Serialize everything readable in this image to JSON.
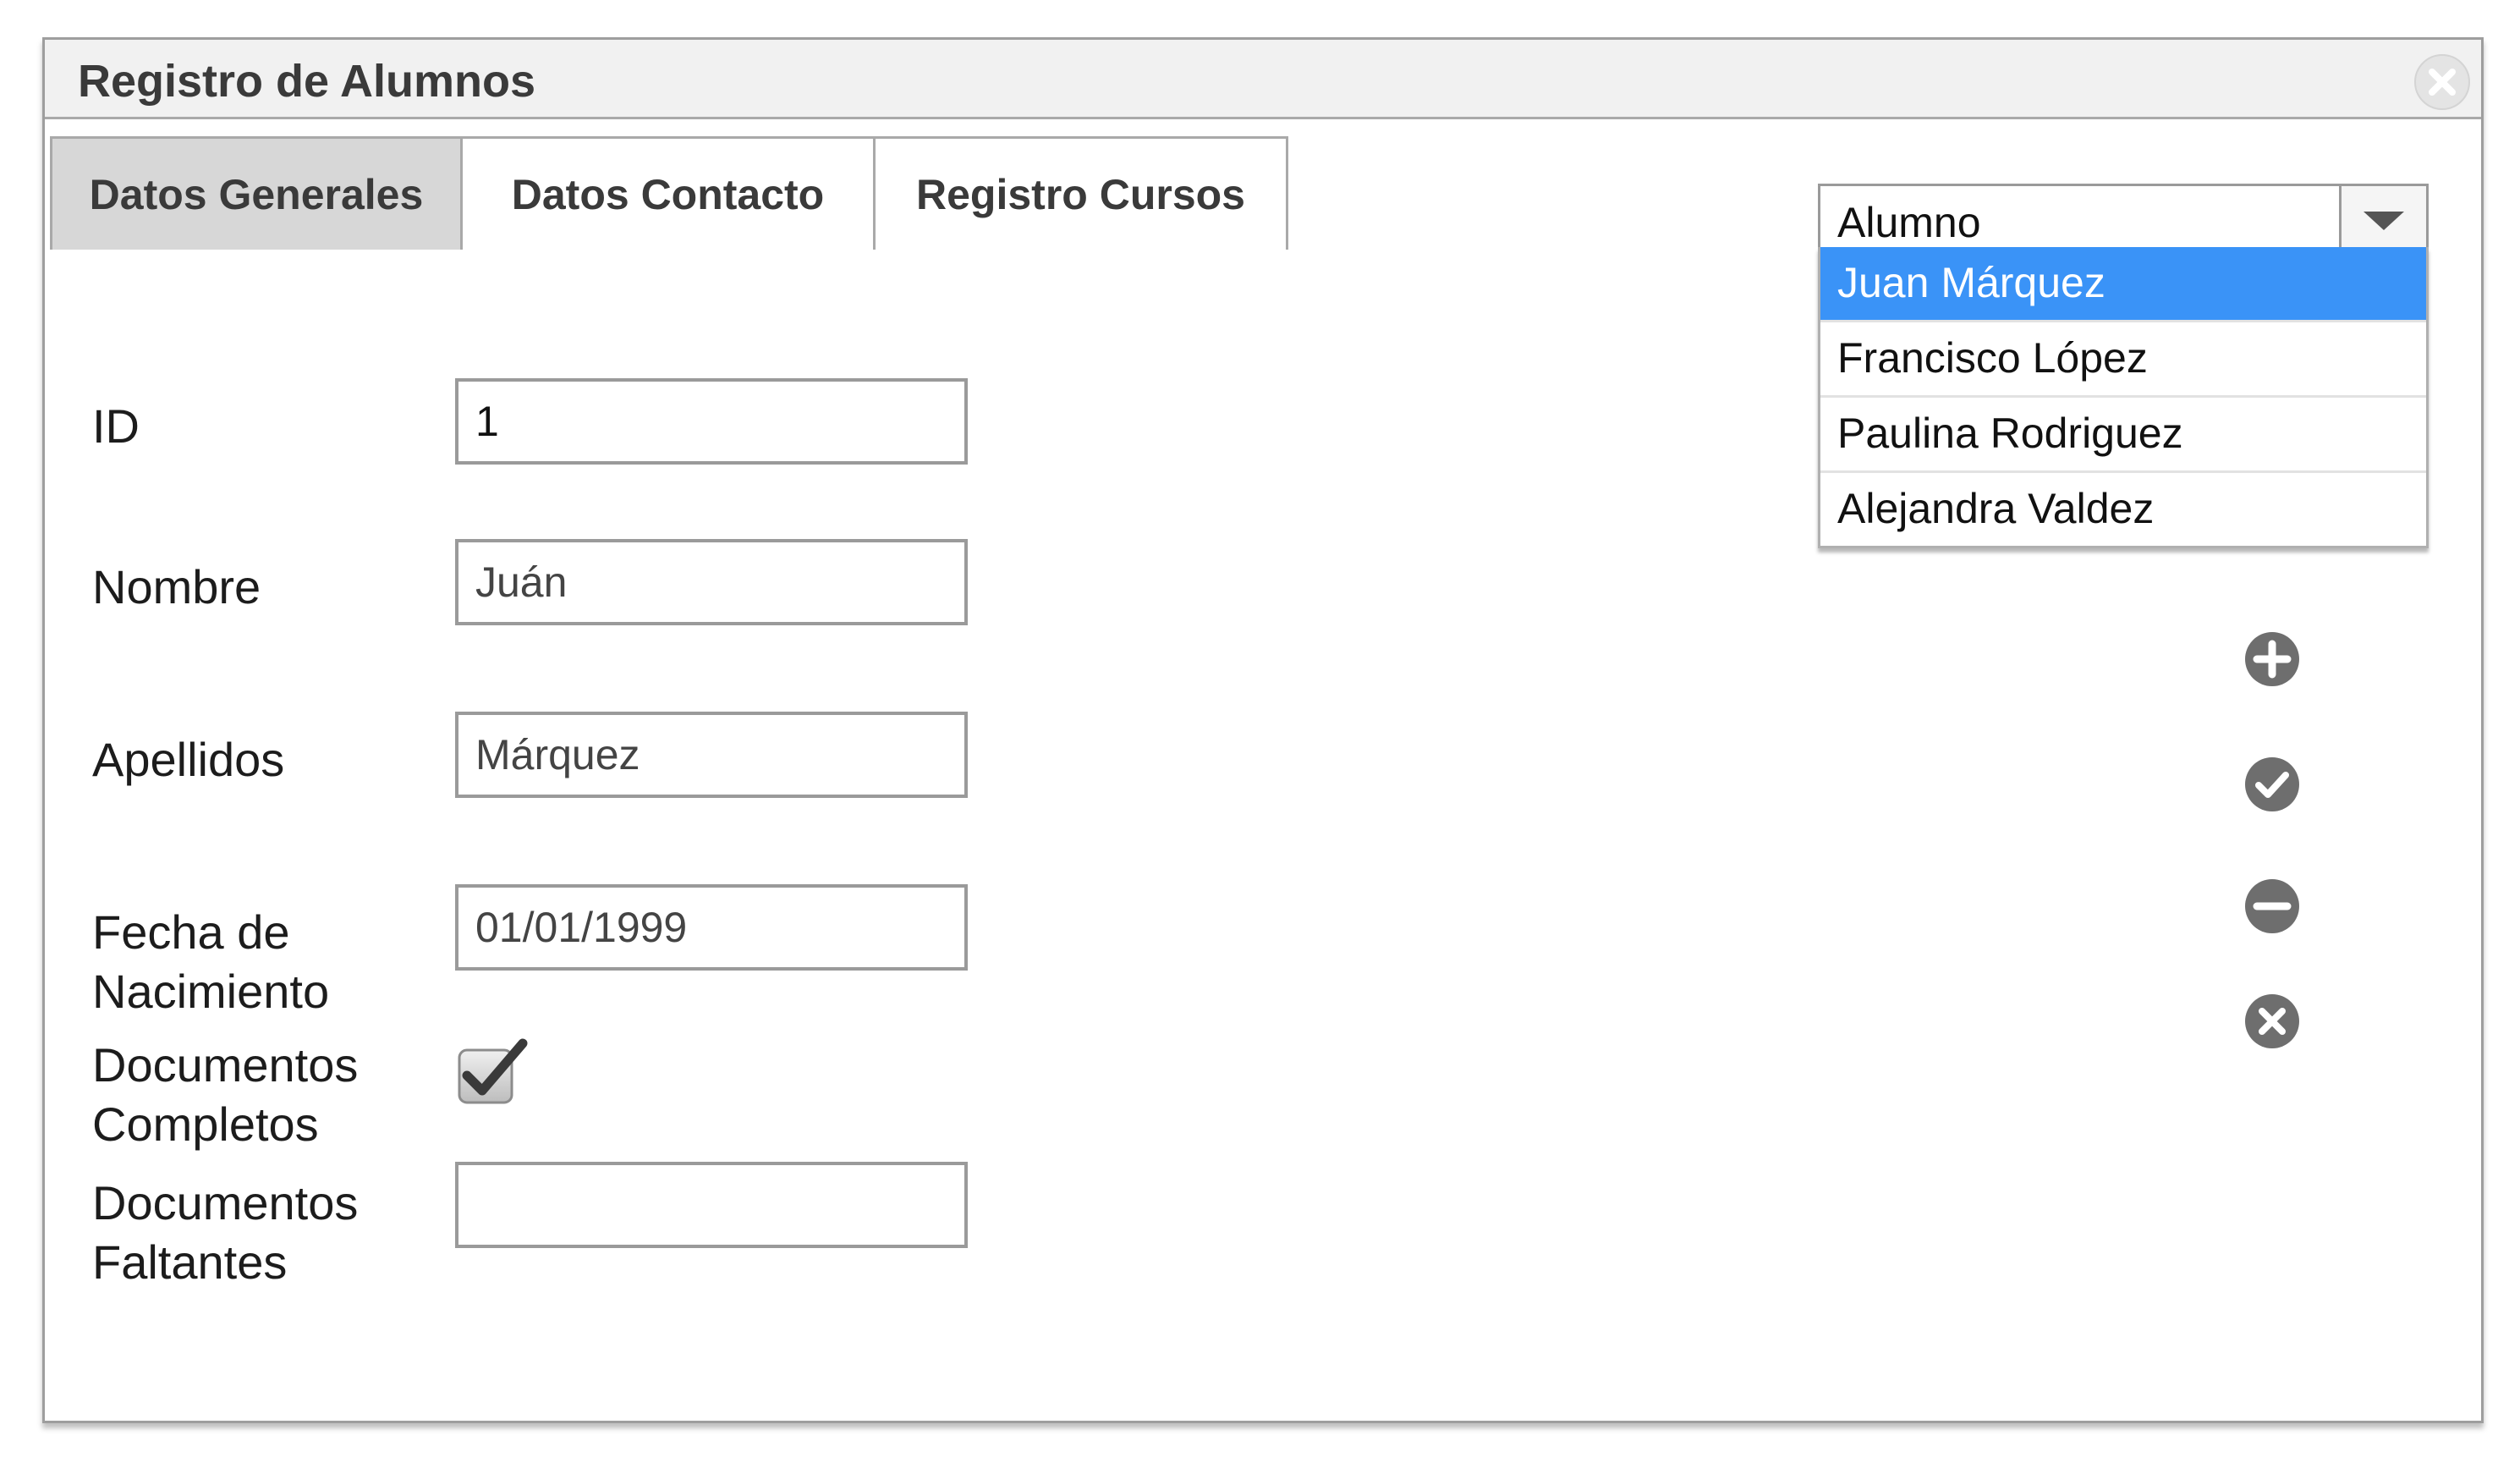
{
  "window": {
    "title": "Registro de Alumnos"
  },
  "tabs": [
    {
      "label": "Datos Generales",
      "active": true
    },
    {
      "label": "Datos Contacto",
      "active": false
    },
    {
      "label": "Registro Cursos",
      "active": false
    }
  ],
  "form": {
    "id_label": "ID",
    "id_value": "1",
    "nombre_label": "Nombre",
    "nombre_value": "Juán",
    "apellidos_label": "Apellidos",
    "apellidos_value": "Márquez",
    "fecha_label_line1": "Fecha de",
    "fecha_label_line2": "Nacimiento",
    "fecha_value": "01/01/1999",
    "docs_completos_label_line1": "Documentos",
    "docs_completos_label_line2": "Completos",
    "docs_completos_checked": true,
    "docs_faltantes_label_line1": "Documentos",
    "docs_faltantes_label_line2": "Faltantes",
    "docs_faltantes_value": ""
  },
  "alumno_select": {
    "value": "Alumno",
    "options": [
      {
        "label": "Juan Márquez",
        "selected": true
      },
      {
        "label": "Francisco López",
        "selected": false
      },
      {
        "label": "Paulina Rodriguez",
        "selected": false
      },
      {
        "label": "Alejandra Valdez",
        "selected": false
      }
    ]
  },
  "actions": [
    {
      "icon": "plus-circle-icon"
    },
    {
      "icon": "check-circle-icon"
    },
    {
      "icon": "minus-circle-icon"
    },
    {
      "icon": "close-circle-icon"
    }
  ],
  "colors": {
    "selection": "#3a93f7",
    "icon_gray": "#707070",
    "active_tab": "#d7d7d7"
  }
}
